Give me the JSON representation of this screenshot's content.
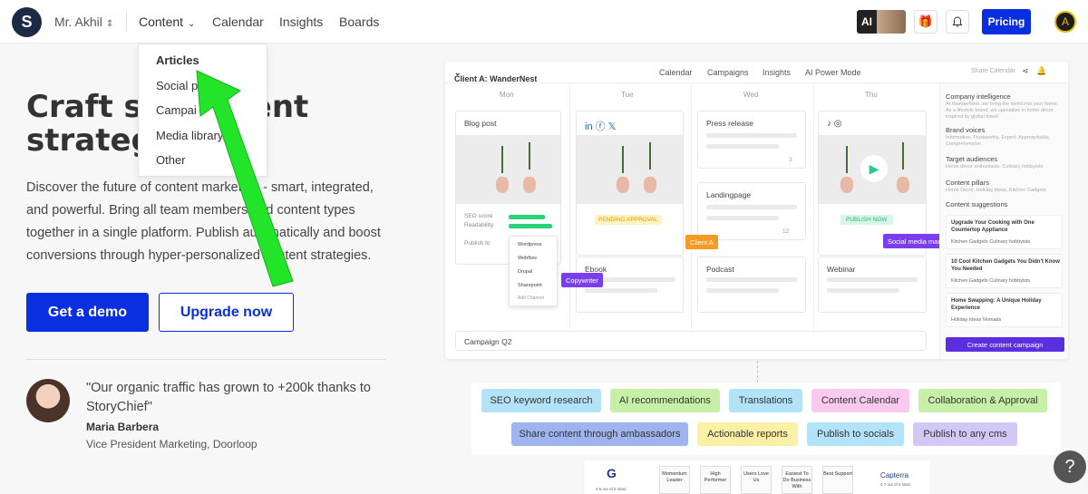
{
  "header": {
    "user": "Mr. Akhil",
    "nav": [
      "Content",
      "Calendar",
      "Insights",
      "Boards"
    ],
    "ai_label": "AI",
    "pricing": "Pricing"
  },
  "dropdown": {
    "items": [
      "Articles",
      "Social p",
      "Campai",
      "Media library",
      "Other"
    ]
  },
  "hero": {
    "headline": "Craft su    content strateg",
    "description": "Discover the future of content marketing - smart, integrated, and powerful. Bring all team members and content types together in a single platform. Publish automatically and boost conversions through hyper-personalized content strategies.",
    "demo_button": "Get a demo",
    "upgrade_button": "Upgrade now"
  },
  "testimonial": {
    "quote": "\"Our organic traffic has grown to +200k thanks to StoryChief\"",
    "name": "Maria Barbera",
    "role": "Vice President Marketing, Doorloop"
  },
  "panel": {
    "client": "Client A: WanderNest",
    "tabs": [
      "Calendar",
      "Campaigns",
      "Insights",
      "AI Power Mode"
    ],
    "share": "Share Calendar",
    "days": [
      "Mon",
      "Tue",
      "Wed",
      "Thu"
    ],
    "cards": {
      "blog": "Blog post",
      "press": "Press release",
      "landing": "Landingpage",
      "ebook": "Ebook",
      "podcast": "Podcast",
      "webinar": "Webinar",
      "campaign": "Campaign Q2"
    },
    "seo": "SEO score",
    "readability": "Readability",
    "publish_to": "Publish to",
    "channels": [
      "Wordpress",
      "Webflow",
      "Drupal",
      "Sharepoint"
    ],
    "add_channel": "Add Channel",
    "pending": "PENDING APPROVAL",
    "publish_now": "PUBLISH NOW",
    "count_a": "3",
    "count_b": "12",
    "tags": {
      "client": "Client A",
      "social": "Social media manager",
      "copy": "Copywriter"
    },
    "side": {
      "intel": "Company intelligence",
      "intel_sub": "At WanderNest, we bring the world into your home. As a lifestyle brand, we specialize in home decor inspired by global travel.",
      "voices": "Brand voices",
      "voices_sub": "Informative, Trustworthy, Expert, Approachable, Comprehensive.",
      "audiences": "Target audiences",
      "audiences_sub": "Home decor enthusiasts, Culinary hobbyists",
      "pillars": "Content pillars",
      "pillars_sub": "Home Decor, Holiday Ideas, Kitchen Gadgets",
      "suggestions": "Content suggestions",
      "s1": "Upgrade Your Cooking with One Countertop Appliance",
      "s1m": "Kitchen Gadgets    Culinary hobbyists",
      "s2": "10 Cool Kitchen Gadgets You Didn't Know You Needed",
      "s2m": "Kitchen Gadgets    Culinary hobbyists",
      "s3": "Home Swapping: A Unique Holiday Experience",
      "s3m": "Holiday Ideas    Nomads",
      "cta": "Create content campaign"
    }
  },
  "features": [
    "SEO keyword research",
    "AI recommendations",
    "Translations",
    "Content Calendar",
    "Collaboration & Approval",
    "Share content through ambassadors",
    "Actionable reports",
    "Publish to socials",
    "Publish to any cms"
  ],
  "ratings": {
    "g2": "4.6 out of 5 stars",
    "badges": [
      "Momentum Leader",
      "High Performer",
      "Users Love Us",
      "Easiest To Do Business With",
      "Best Support"
    ],
    "capterra": "Capterra",
    "capterra_score": "4.7 out of 5 stars"
  },
  "help": "?",
  "colors": {
    "primary": "#0a2fe0",
    "arrow": "#22e52a",
    "purple": "#7a3ef0",
    "orange": "#f59a23"
  }
}
